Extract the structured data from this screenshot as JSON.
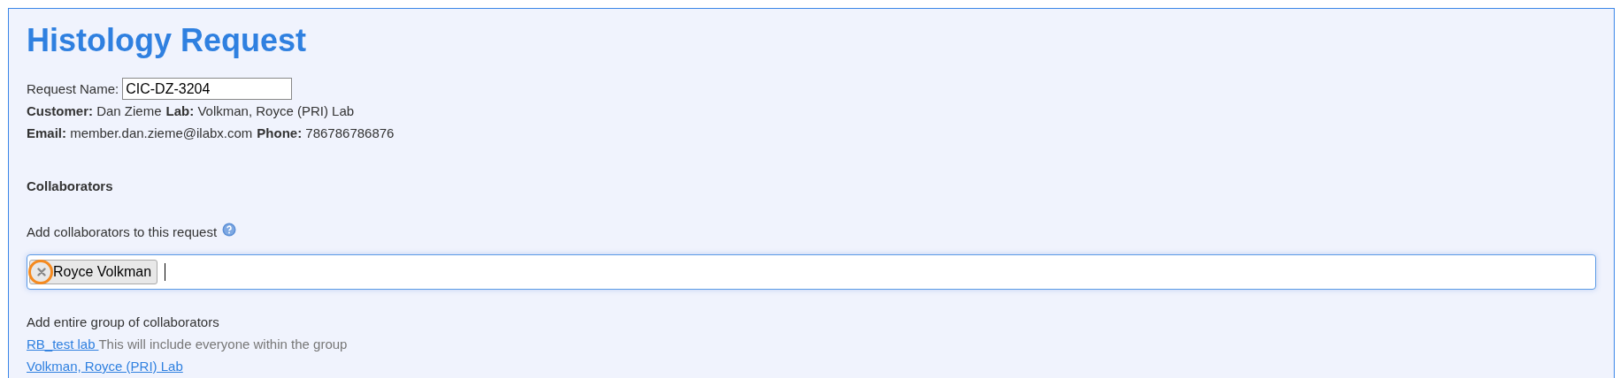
{
  "title": "Histology Request",
  "request_name": {
    "label": "Request Name:",
    "value": "CIC-DZ-3204"
  },
  "info_lines": [
    [
      {
        "label": "Customer:",
        "value": "Dan Zieme"
      },
      {
        "label": "Lab:",
        "value": "Volkman, Royce (PRI) Lab"
      }
    ],
    [
      {
        "label": "Email:",
        "value": "member.dan.zieme@ilabx.com"
      },
      {
        "label": "Phone:",
        "value": "786786786876"
      }
    ]
  ],
  "collaborators": {
    "heading": "Collaborators",
    "add_label": "Add collaborators to this request",
    "tokens": [
      {
        "label": "Royce Volkman"
      }
    ]
  },
  "groups": {
    "heading": "Add entire group of collaborators",
    "items": [
      {
        "link": "RB_test lab ",
        "note": "This will include everyone within the group"
      },
      {
        "link": "Volkman, Royce (PRI) Lab"
      }
    ]
  }
}
